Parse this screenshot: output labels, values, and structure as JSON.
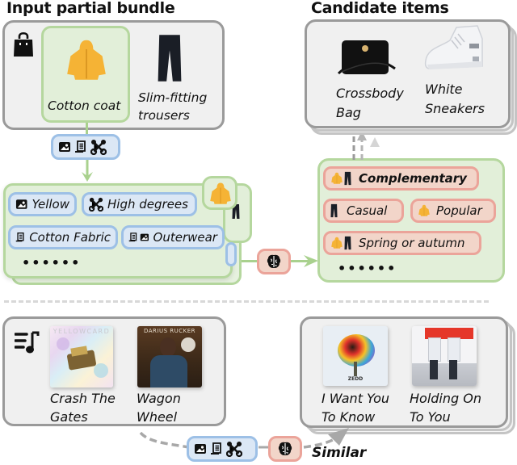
{
  "fashion": {
    "input_title": "Input partial bundle",
    "candidate_title": "Candidate items",
    "input_items": [
      {
        "label": "Cotton coat",
        "image": "yellow-coat"
      },
      {
        "label": "Slim-fitting trousers",
        "label_lines": [
          "Slim-fitting",
          "trousers"
        ],
        "image": "black-trousers"
      }
    ],
    "candidate_items": [
      {
        "label_lines": [
          "Crossbody",
          "Bag"
        ],
        "image": "black-crossbody-bag"
      },
      {
        "label_lines": [
          "White",
          "Sneakers"
        ],
        "image": "white-sneakers"
      }
    ],
    "modality_icons": [
      "image-icon",
      "text-document-icon",
      "graph-network-icon"
    ],
    "attributes": [
      {
        "icons": [
          "image-icon"
        ],
        "label": "Yellow"
      },
      {
        "icons": [
          "graph-network-icon"
        ],
        "label": "High degrees"
      },
      {
        "icons": [
          "text-document-icon"
        ],
        "label": "Cotton Fabric"
      },
      {
        "icons": [
          "text-document-icon",
          "image-icon"
        ],
        "label": "Outerwear"
      }
    ],
    "attributes_more": "••••••",
    "relations": [
      {
        "icons": [
          "coat-thumb",
          "trousers-thumb"
        ],
        "label": "Complementary",
        "bold": true
      },
      {
        "icons": [
          "trousers-thumb"
        ],
        "label": "Casual"
      },
      {
        "icons": [
          "coat-thumb"
        ],
        "label": "Popular"
      },
      {
        "icons": [
          "coat-thumb",
          "trousers-thumb"
        ],
        "label": "Spring or autumn"
      }
    ],
    "relations_more": "••••••",
    "llm_icon": "brain-icon",
    "bundle_icon": "shopping-bag-icon"
  },
  "music": {
    "playlist_icon": "playlist-icon",
    "input_items": [
      {
        "label_lines": [
          "Crash The",
          "Gates"
        ],
        "album_text": "YELLOWCARD"
      },
      {
        "label_lines": [
          "Wagon",
          "Wheel"
        ],
        "album_text": "DARIUS RUCKER"
      }
    ],
    "candidate_items": [
      {
        "label_lines": [
          "I Want You",
          "To Know"
        ],
        "album_text": "ZEDD"
      },
      {
        "label_lines": [
          "Holding On",
          "To You"
        ]
      }
    ],
    "relation_label": "Similar"
  },
  "colors": {
    "green_fill": "#e2efd9",
    "green_border": "#b5d79e",
    "blue_fill": "#dbe7f5",
    "blue_border": "#9dc0e6",
    "red_fill": "#f2d5c9",
    "red_border": "#eba49a",
    "gray_border": "#9a9a9a",
    "coat_yellow": "#f5b335"
  }
}
